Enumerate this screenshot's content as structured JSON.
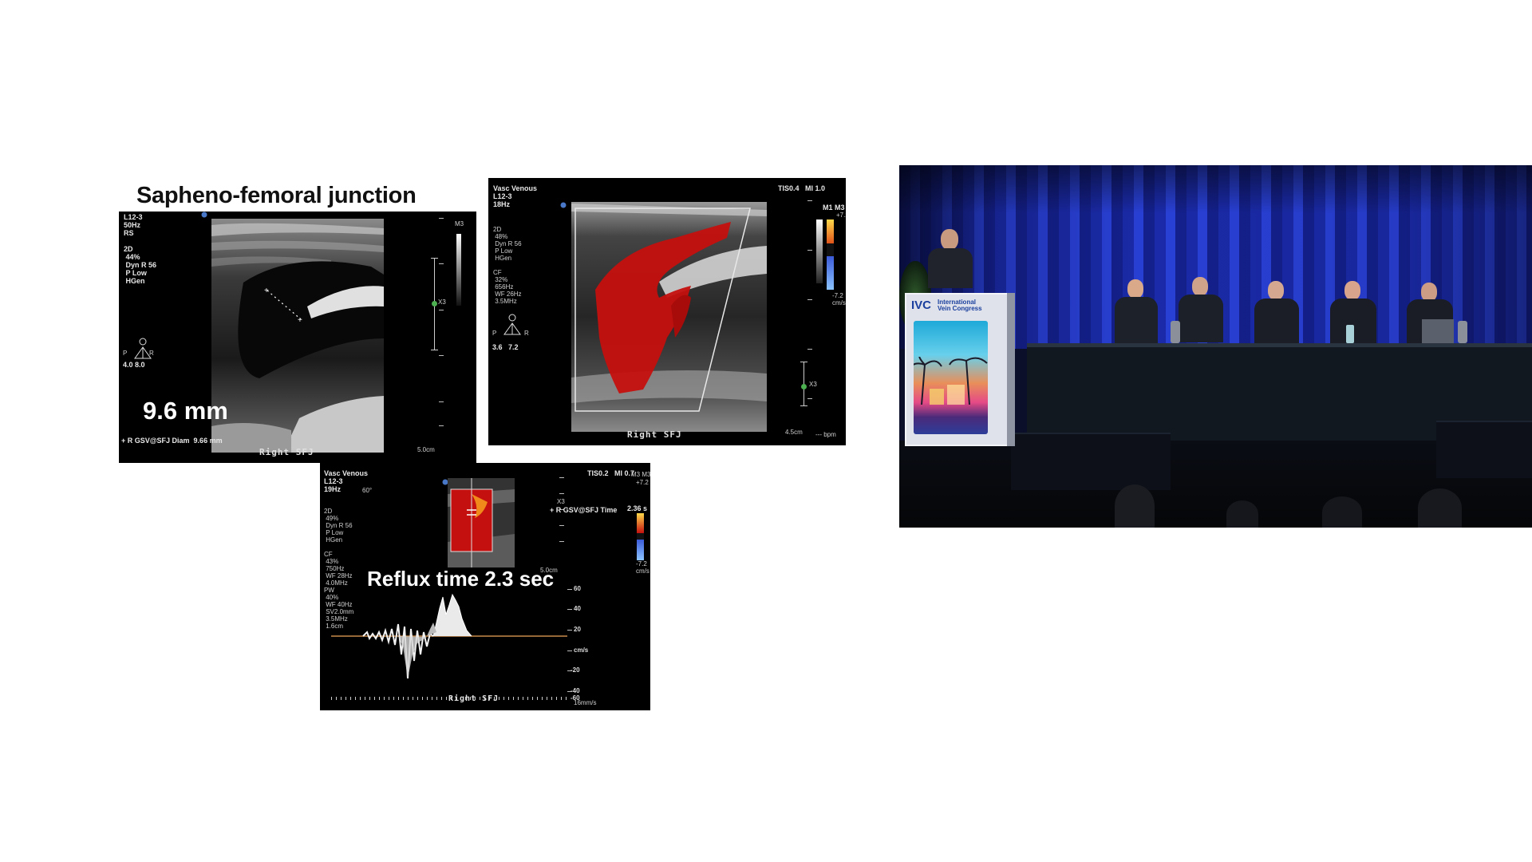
{
  "slide": {
    "title": "Sapheno-femoral junction",
    "panel1": {
      "params": "L12-3\n50Hz\nRS\n\n2D\n 44%\n Dyn R 56\n P Low\n HGen",
      "probe_values": "4.0 8.0",
      "pr_left": "P",
      "pr_right": "R",
      "measurement": "9.6 mm",
      "caliper": "+ R GSV@SFJ Diam  9.66 mm",
      "label": "Right   SFJ",
      "depth": "5.0cm",
      "map": "M3",
      "zoom": "X3"
    },
    "panel2": {
      "header_left": "Vasc Venous\nL12-3\n18Hz",
      "header_right": "TIS0.4   MI 1.0",
      "params": "2D\n 48%\n Dyn R 56\n P Low\n HGen\n\nCF\n 32%\n 656Hz\n WF 26Hz\n 3.5MHz",
      "probe_values": "3.6   7.2",
      "pr_left": "P",
      "pr_right": "R",
      "map": "M1 M3",
      "scale_top": "+7.2",
      "scale_bottom": "-7.2\ncm/s",
      "zoom": "X3",
      "label": "Right   SFJ",
      "depth": "4.5cm",
      "bpm": "--- bpm"
    },
    "panel3": {
      "header_left": "Vasc Venous\nL12-3\n19Hz",
      "angle": "60°",
      "header_right": "TIS0.2   MI 0.7",
      "params": "2D\n 49%\n Dyn R 56\n P Low\n HGen\n\nCF\n 43%\n 750Hz\n WF 28Hz\n 4.0MHz\nPW\n 40%\n WF 40Hz\n SV2.0mm\n 3.5MHz\n 1.6cm",
      "map": "M3 M3",
      "scale_top": "+7.2",
      "scale_bottom": "-7.2\ncm/s",
      "measure_label": "+ R GSV@SFJ Time",
      "measure_value": "2.36 s",
      "zoom": "X3",
      "depth": "5.0cm",
      "reflux": "Reflux time 2.3 sec",
      "velocity_ticks": [
        "60",
        "40",
        "20",
        "cm/s",
        "-20",
        "-40",
        "-60"
      ],
      "label": "Right   SFJ",
      "sweep": "16mm/s"
    }
  },
  "video": {
    "logo_mark": "IVC",
    "logo_line1": "International",
    "logo_line2": "Vein Congress"
  },
  "colors": {
    "doppler_red": "#c4100e",
    "curtain_blue": "#1c2fb8",
    "baseline": "#c88a4a"
  }
}
